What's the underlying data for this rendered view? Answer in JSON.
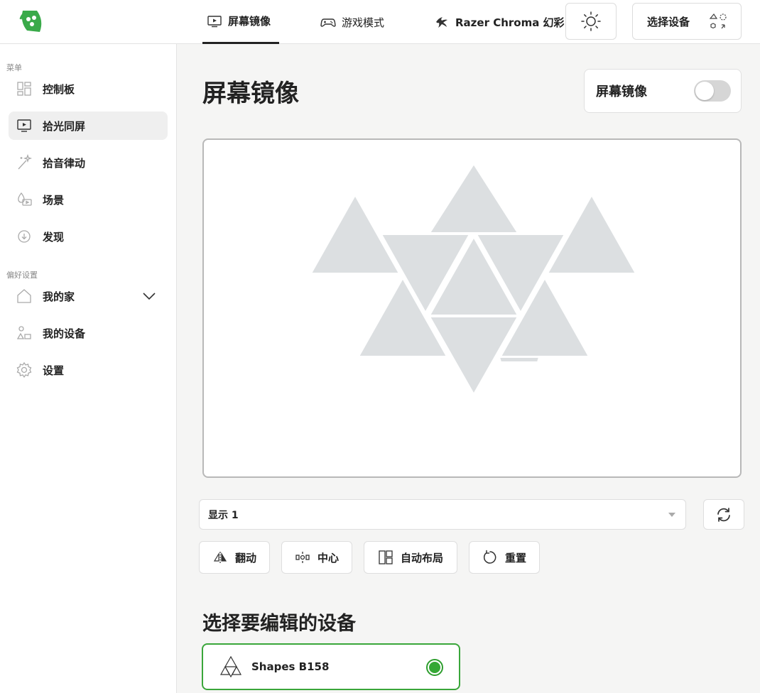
{
  "header": {
    "tabs": [
      {
        "label": "屏幕镜像",
        "icon": "monitor-play-icon",
        "active": true
      },
      {
        "label": "游戏模式",
        "icon": "gamepad-icon",
        "active": false
      },
      {
        "label": "Razer Chroma 幻彩",
        "icon": "razer-icon",
        "active": false
      }
    ],
    "brightness_icon": "sun-icon",
    "select_device_label": "选择设备",
    "select_device_icon": "shapes-swap-icon"
  },
  "sidebar": {
    "menu_label": "菜单",
    "menu_items": [
      {
        "label": "控制板",
        "icon": "dashboard-icon",
        "active": false
      },
      {
        "label": "拾光同屏",
        "icon": "monitor-play-icon",
        "active": true
      },
      {
        "label": "拾音律动",
        "icon": "magic-wand-icon",
        "active": false
      },
      {
        "label": "场景",
        "icon": "scene-icon",
        "active": false
      },
      {
        "label": "发现",
        "icon": "download-cloud-icon",
        "active": false
      }
    ],
    "prefs_label": "偏好设置",
    "pref_items": [
      {
        "label": "我的家",
        "icon": "home-icon",
        "expandable": true
      },
      {
        "label": "我的设备",
        "icon": "devices-icon"
      },
      {
        "label": "设置",
        "icon": "gear-icon"
      }
    ]
  },
  "main": {
    "title": "屏幕镜像",
    "toggle_label": "屏幕镜像",
    "toggle_on": false,
    "display_select": "显示 1",
    "actions": {
      "flip": "翻动",
      "center": "中心",
      "auto_layout": "自动布局",
      "reset": "重置"
    },
    "section_title": "选择要编辑的设备",
    "device": {
      "name": "Shapes B158",
      "selected": true,
      "icon": "shapes-layout-icon"
    }
  },
  "colors": {
    "accent_green": "#35a835",
    "panel_gray": "#dcdfe1",
    "logo_green": "#3aaa4a"
  }
}
